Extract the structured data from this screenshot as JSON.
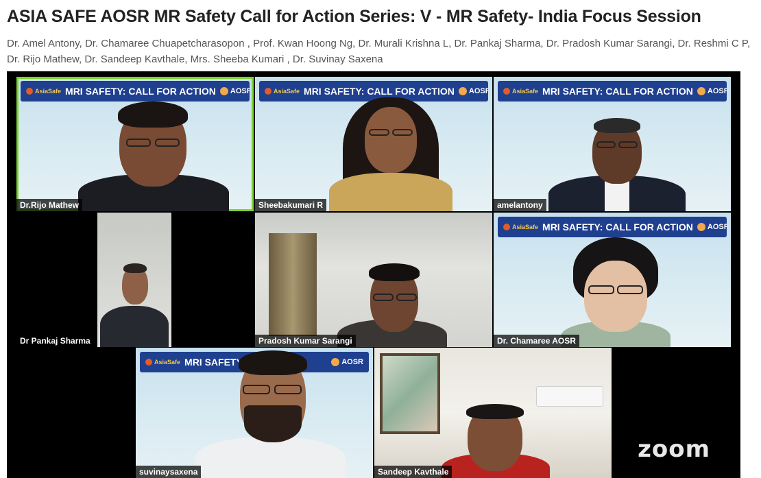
{
  "page": {
    "title": "ASIA SAFE AOSR MR Safety Call for Action Series: V - MR Safety- India Focus Session",
    "authors": "Dr. Amel Antony, Dr. Chamaree Chuapetcharasopon , Prof. Kwan Hoong Ng, Dr. Murali Krishna L, Dr. Pankaj Sharma, Dr. Pradosh Kumar Sarangi, Dr. Reshmi C P, Dr. Rijo Mathew, Dr. Sandeep Kavthale, Mrs. Sheeba Kumari , Dr. Suvinay Saxena"
  },
  "banner": {
    "left_logo": "AsiaSafe",
    "text_full": "MRI SAFETY: CALL FOR ACTION",
    "text_short": "MRI SAFETY:",
    "right_logo": "AOSR"
  },
  "tiles": [
    {
      "name": "Dr.Rijo Mathew",
      "active": true
    },
    {
      "name": "Sheebakumari R"
    },
    {
      "name": "amelantony"
    },
    {
      "name": "Dr Pankaj Sharma"
    },
    {
      "name": "Pradosh Kumar Sarangi"
    },
    {
      "name": "Dr. Chamaree AOSR"
    },
    {
      "name": "suvinaysaxena"
    },
    {
      "name": "Sandeep Kavthale"
    }
  ],
  "watermark": "zoom",
  "colors": {
    "active_speaker_border": "#7cd32f",
    "banner_bg": "#1f3f8f",
    "video_bg": "#000000"
  }
}
